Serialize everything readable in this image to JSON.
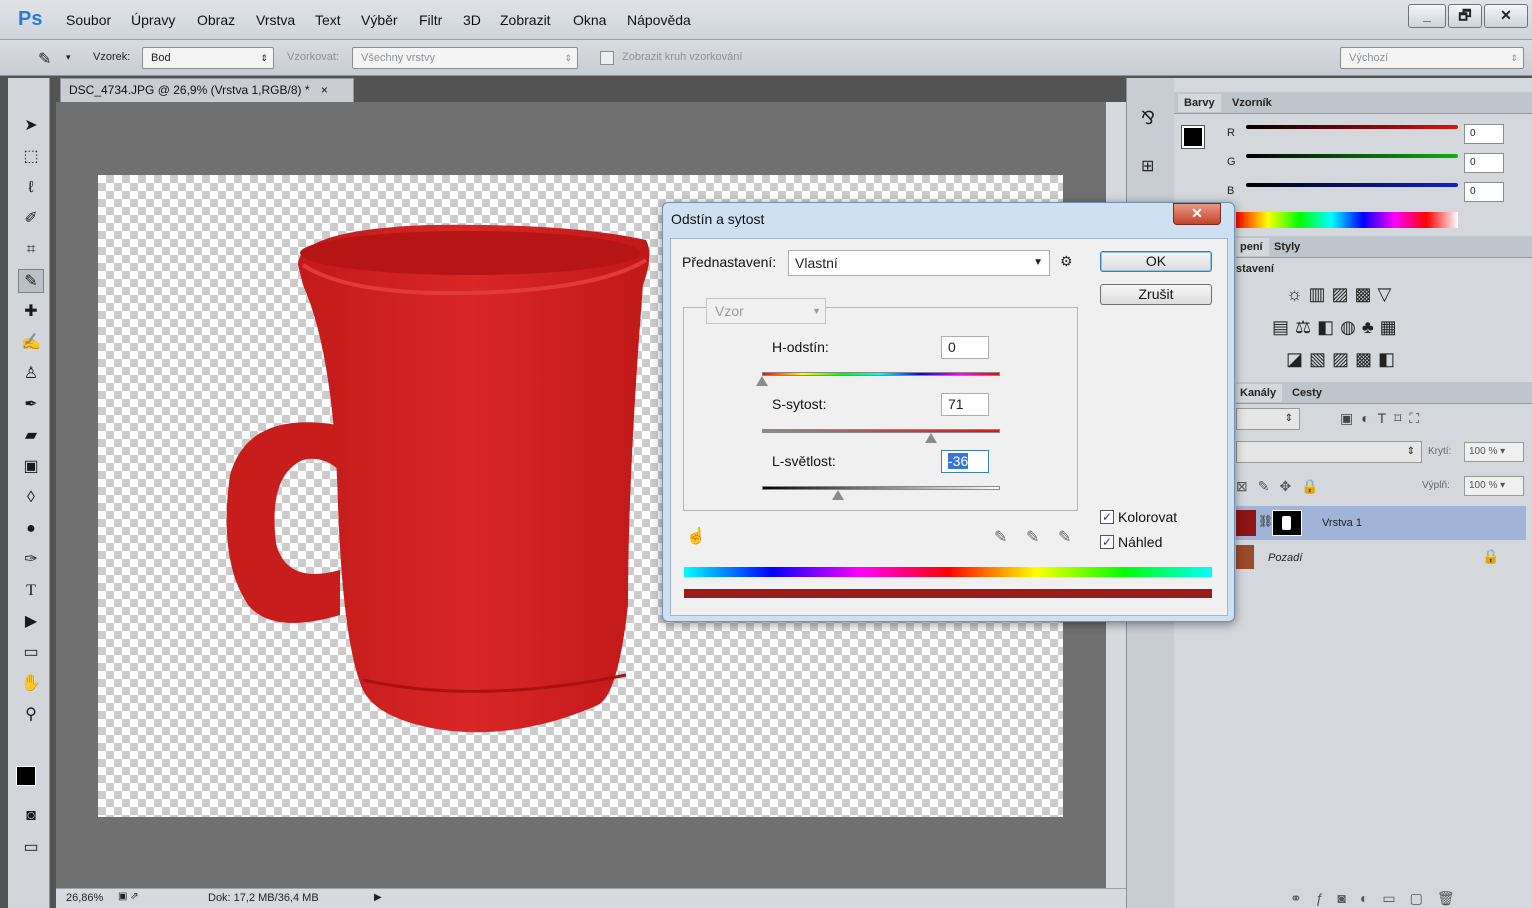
{
  "menubar": {
    "logo": "Ps",
    "items": [
      "Soubor",
      "Úpravy",
      "Obraz",
      "Vrstva",
      "Text",
      "Výběr",
      "Filtr",
      "3D",
      "Zobrazit",
      "Okna",
      "Nápověda"
    ],
    "window_buttons": [
      "_",
      "🗗",
      "✕"
    ]
  },
  "options": {
    "sample_label": "Vzorek:",
    "sample_value": "Bod",
    "layers_label": "Vzorkovat:",
    "layers_value": "Všechny vrstvy",
    "ring_label": "Zobrazit kruh vzorkování",
    "workspace": "Výchozí"
  },
  "document": {
    "tab_title": "DSC_4734.JPG @ 26,9% (Vrstva 1,RGB/8) *",
    "tab_close": "×"
  },
  "statusbar": {
    "zoom": "26,86%",
    "doc_size": "Dok: 17,2 MB/36,4 MB"
  },
  "color_panel": {
    "tabs": [
      "Barvy",
      "Vzorník"
    ],
    "channels": [
      {
        "name": "R",
        "value": "0",
        "color": "#e01010"
      },
      {
        "name": "G",
        "value": "0",
        "color": "#10b010"
      },
      {
        "name": "B",
        "value": "0",
        "color": "#1020d0"
      }
    ]
  },
  "adjustments_panel": {
    "tab_partial": "pení",
    "tab_styles": "Styly",
    "heading_partial": "stavení"
  },
  "layers_panel": {
    "tab_channels": "Kanály",
    "tab_paths": "Cesty",
    "opacity_label": "Krytí:",
    "opacity_value": "100 %",
    "fill_label": "Výplň:",
    "fill_value": "100 %",
    "layers": [
      {
        "name": "Vrstva 1",
        "selected": true
      },
      {
        "name": "Pozadí",
        "selected": false,
        "locked": true
      }
    ]
  },
  "dialog": {
    "title": "Odstín a sytost",
    "close": "✕",
    "preset_label": "Přednastavení:",
    "preset_value": "Vlastní",
    "ok": "OK",
    "cancel": "Zrušit",
    "channel_select": "Vzor",
    "hue_label": "H-odstín:",
    "hue_value": "0",
    "saturation_label": "S-sytost:",
    "saturation_value": "71",
    "lightness_label": "L-světlost:",
    "lightness_value": "-36",
    "hue_level": 0.0,
    "saturation_level": 0.71,
    "lightness_level": 0.32,
    "colorize_label": "Kolorovat",
    "colorize_checked": true,
    "preview_label": "Náhled",
    "preview_checked": true,
    "result_color": "#9b1a1a"
  },
  "colors": {
    "mug_red": "#d42424",
    "foreground": "#000000",
    "background": "#ffffff"
  }
}
